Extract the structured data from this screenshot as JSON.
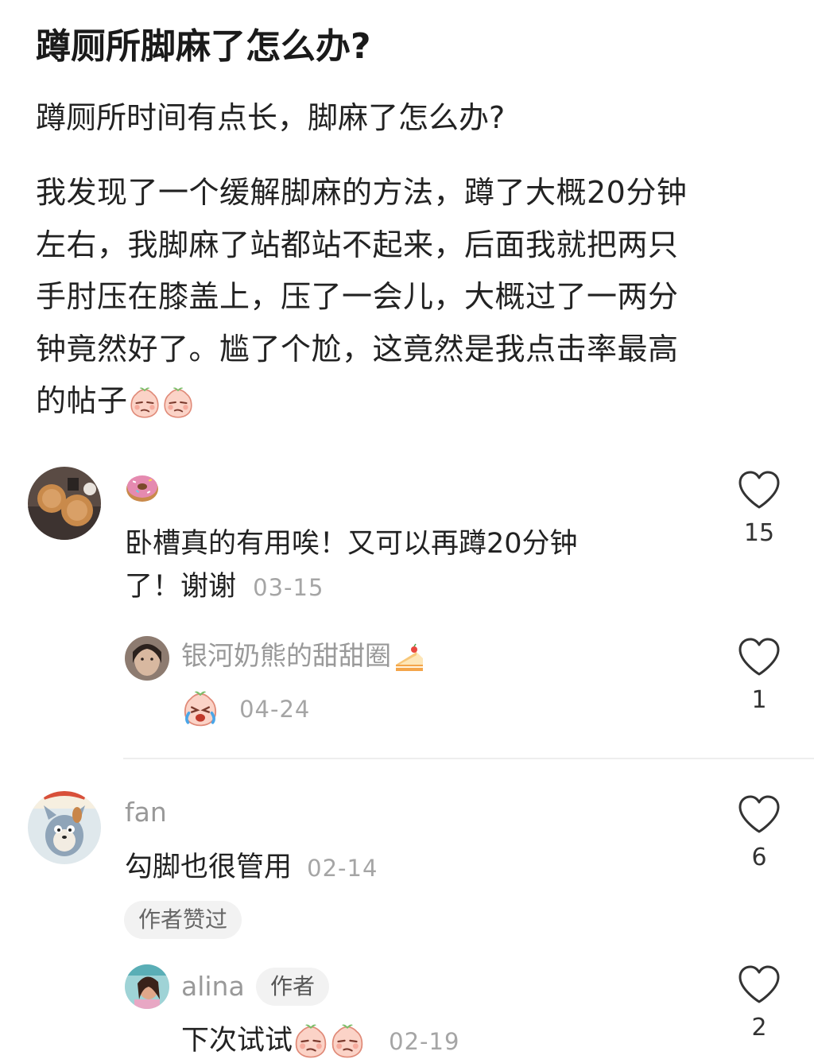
{
  "post": {
    "title": "蹲厕所脚麻了怎么办?",
    "subtitle": "蹲厕所时间有点长，脚麻了怎么办?",
    "body_lines": [
      "我发现了一个缓解脚麻的方法，蹲了大概20分钟",
      "左右，我脚麻了站都站不起来，后面我就把两只",
      "手肘压在膝盖上，压了一会儿，大概过了一两分",
      "钟竟然好了。尴了个尬，这竟然是我点击率最高",
      "的帖子"
    ],
    "body_end_emojis": [
      "peach-smirk-emoji",
      "peach-smirk-emoji"
    ]
  },
  "comments": [
    {
      "user_emoji": "donut-emoji",
      "text_line1": "卧槽真的有用唉！又可以再蹲20分钟",
      "text_line2": "了！谢谢",
      "date": "03-15",
      "likes": "15",
      "avatar": "waffle-photo-avatar",
      "reply": {
        "username": "银河奶熊的甜甜圈",
        "username_emoji": "cake-emoji",
        "text_emoji": "peach-crying-emoji",
        "date": "04-24",
        "likes": "1",
        "avatar": "girl-photo-avatar"
      }
    },
    {
      "username": "fan",
      "text": "勾脚也很管用",
      "date": "02-14",
      "likes": "6",
      "badge": "作者赞过",
      "avatar": "cartoon-cat-avatar",
      "reply": {
        "username": "alina",
        "author_tag": "作者",
        "text": "下次试试",
        "text_emojis": [
          "peach-smirk-emoji",
          "peach-smirk-emoji"
        ],
        "date": "02-19",
        "likes": "2",
        "avatar": "girl-portrait-avatar"
      }
    }
  ],
  "colors": {
    "text_primary": "#222222",
    "text_secondary": "#999999",
    "date": "#a5a5a5",
    "pill_bg": "#f2f2f2",
    "heart_stroke": "#333333"
  }
}
